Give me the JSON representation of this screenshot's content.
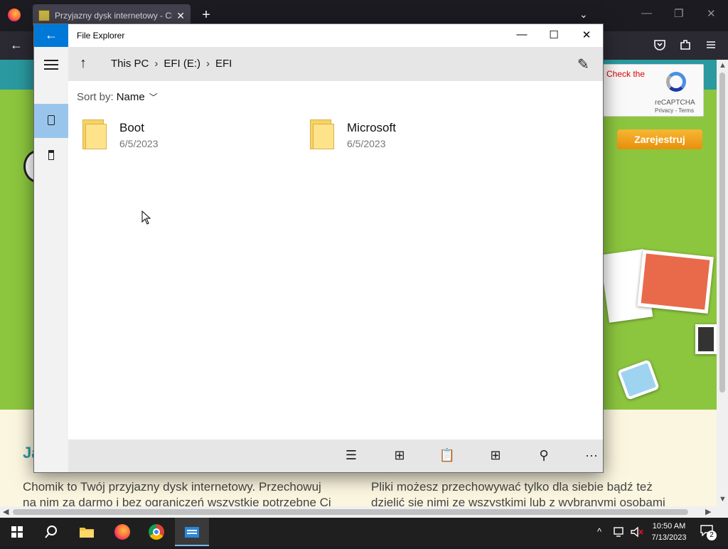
{
  "browser": {
    "tab_title": "Przyjazny dysk internetowy - Ch",
    "new_tab": "+",
    "tab_close": "✕",
    "tab_list": "⌄",
    "minimize": "—",
    "restore": "❐",
    "close": "✕",
    "back": "←"
  },
  "webpage": {
    "recaptcha_check": "Check the",
    "recaptcha_label": "reCAPTCHA",
    "recaptcha_terms": "Privacy - Terms",
    "register_button": "Zarejestruj",
    "heading": "Ja",
    "text_left_1": "Chomik to Twój przyjazny dysk internetowy. Przechowuj",
    "text_left_2": "na nim za darmo i bez ograniczeń wszystkie potrzebne Ci",
    "text_right_1": "Pliki możesz przechowywać tylko dla siebie bądź też",
    "text_right_2": "dzielić się nimi ze wszystkimi lub z wybranymi osobami"
  },
  "explorer": {
    "back": "←",
    "title": "File Explorer",
    "minimize": "—",
    "maximize": "☐",
    "close": "✕",
    "up": "↑",
    "breadcrumb": [
      "This PC",
      "EFI (E:)",
      "EFI"
    ],
    "crumb_sep": "›",
    "edit": "✎",
    "sort_label": "Sort by:",
    "sort_value": "Name",
    "sort_chevron": "﹀",
    "items": [
      {
        "name": "Boot",
        "date": "6/5/2023"
      },
      {
        "name": "Microsoft",
        "date": "6/5/2023"
      }
    ],
    "commands": {
      "select": "☰",
      "new_folder": "⊞",
      "paste": "📋",
      "view": "⊞",
      "search": "⚲",
      "more": "···"
    }
  },
  "taskbar": {
    "search": "⚲",
    "clock_time": "10:50 AM",
    "clock_date": "7/13/2023",
    "notifications_count": "2",
    "tray_chevron": "^"
  }
}
